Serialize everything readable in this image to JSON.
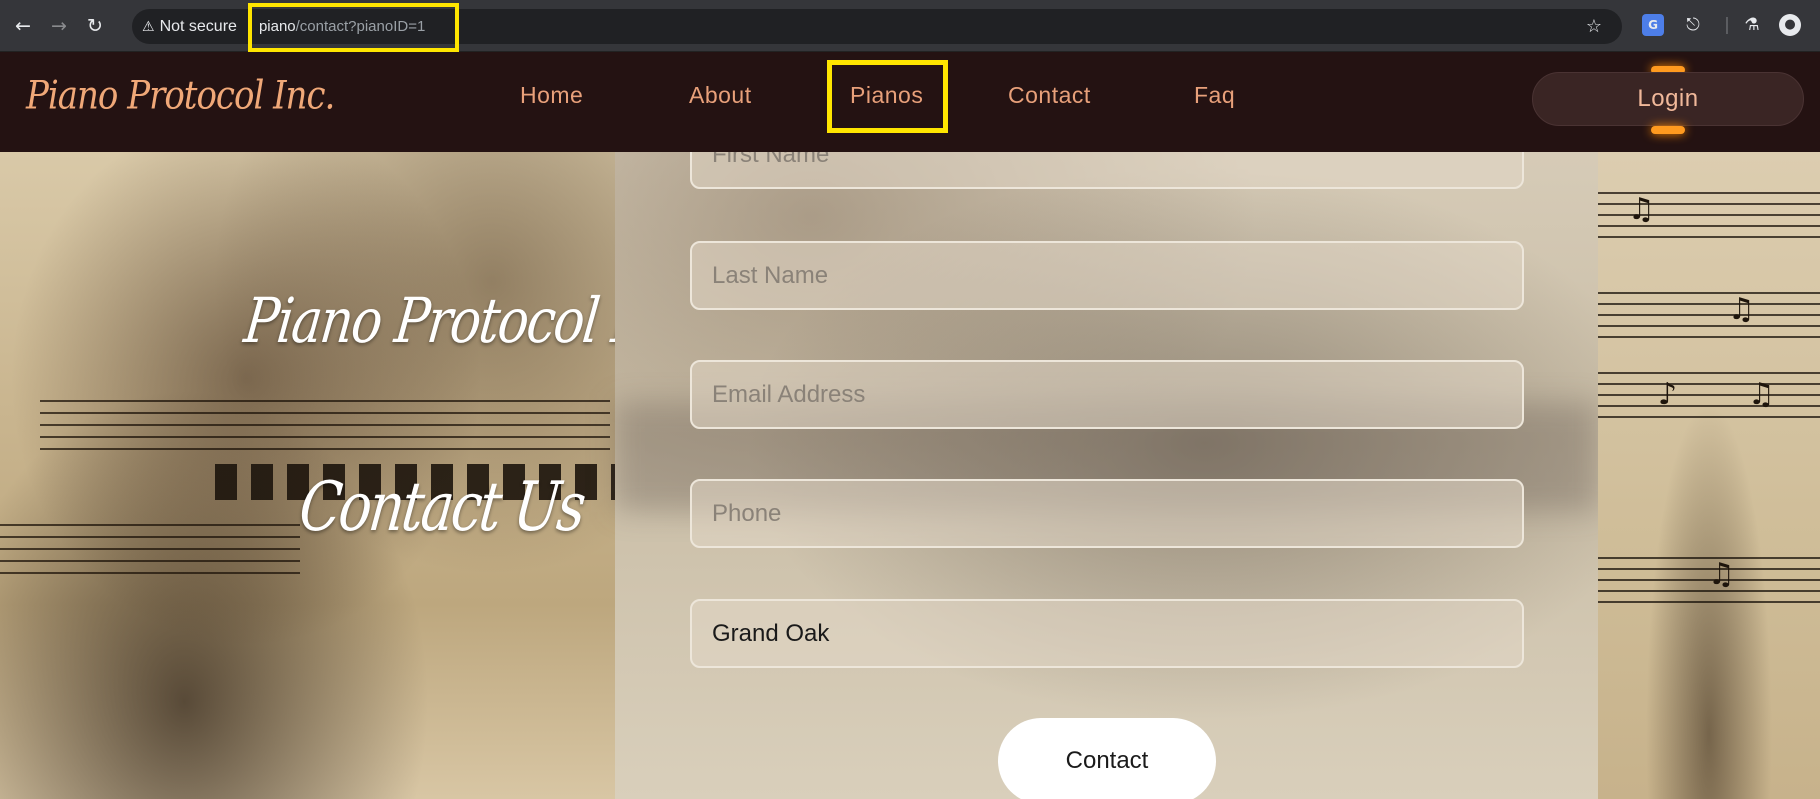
{
  "browser": {
    "security_label": "Not secure",
    "url_host": "piano",
    "url_path": "/contact?pianoID=1",
    "icons": [
      "back-arrow-icon",
      "forward-arrow-icon",
      "reload-icon",
      "warning-icon",
      "star-icon",
      "translate-icon",
      "extensions-icon",
      "labs-icon",
      "profile-icon"
    ]
  },
  "site": {
    "brand": "Piano Protocol Inc.",
    "nav": [
      {
        "label": "Home"
      },
      {
        "label": "About"
      },
      {
        "label": "Pianos"
      },
      {
        "label": "Contact"
      },
      {
        "label": "Faq"
      }
    ],
    "login_label": "Login"
  },
  "hero": {
    "title": "Piano Protocol Inc",
    "subtitle": "Contact Us"
  },
  "form": {
    "first_name_placeholder": "First Name",
    "last_name_placeholder": "Last Name",
    "email_placeholder": "Email Address",
    "phone_placeholder": "Phone",
    "piano_value": "Grand Oak",
    "submit_label": "Contact"
  },
  "colors": {
    "highlight": "#ffe500",
    "nav_link": "#e8a07a",
    "navbar_bg": "#241212",
    "login_glow": "#ff9a1f"
  }
}
